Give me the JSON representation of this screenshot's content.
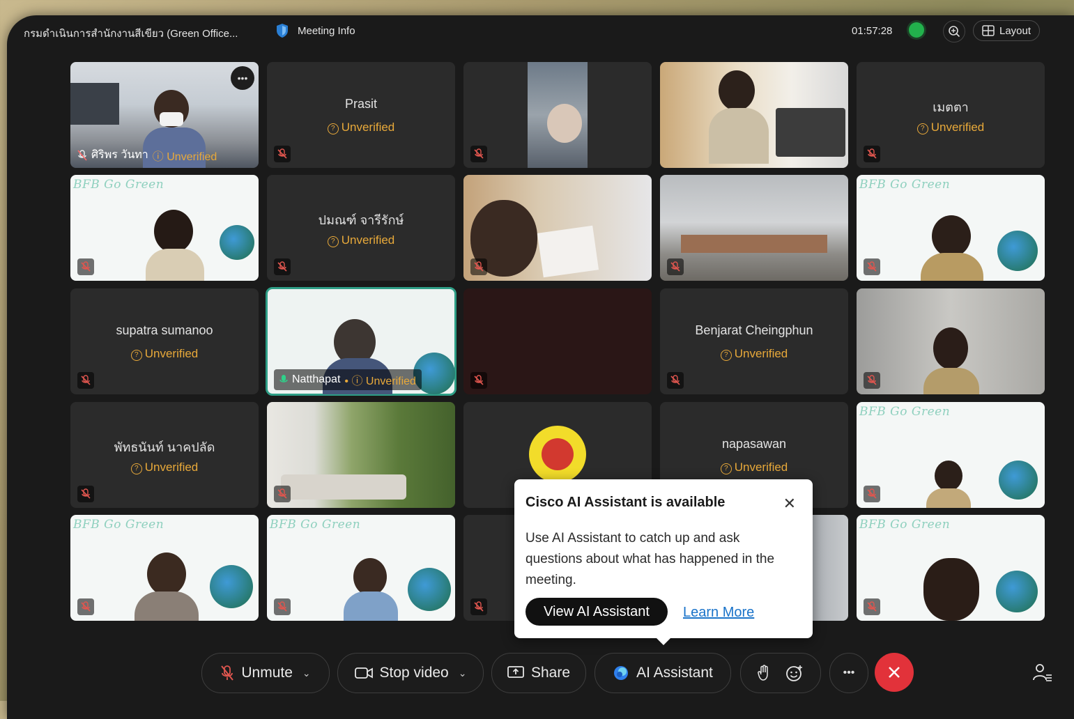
{
  "meeting": {
    "title": "กรมดำเนินการสำนักงานสีเขียว (Green Office...",
    "info_label": "Meeting Info",
    "clock": "01:57:28",
    "layout_label": "Layout"
  },
  "colors": {
    "accent_green": "#22b14c",
    "unverified": "#e8a93a",
    "end_red": "#e2323a",
    "active_border": "#2e9e86"
  },
  "unverified": "Unverified",
  "tiles": {
    "t1": {
      "label": "ศิริพร วันทา"
    },
    "t2": {
      "name": "Prasit"
    },
    "t5": {
      "name": "เมตตา"
    },
    "t6": {
      "banner": "BFB Go Green"
    },
    "t7": {
      "name": "ปมณฑ์ จารีรักษ์"
    },
    "t10": {
      "banner": "BFB Go Green"
    },
    "t11": {
      "name": "supatra sumanoo"
    },
    "t12": {
      "label": "Natthapat"
    },
    "t14": {
      "name": "Benjarat Cheingphun"
    },
    "t16": {
      "name": "พัทธนันท์ นาคปลัด"
    },
    "t19": {
      "name": "napasawan"
    },
    "t20": {
      "banner": "BFB Go Green"
    },
    "t21": {
      "banner": "BFB Go Green"
    },
    "t22": {
      "banner": "BFB Go Green"
    },
    "t25": {
      "banner": "BFB Go Green"
    }
  },
  "popup": {
    "title": "Cisco AI Assistant is available",
    "body": "Use AI Assistant to catch up and ask questions about what has happened in the meeting.",
    "primary": "View AI Assistant",
    "link": "Learn More"
  },
  "controls": {
    "unmute": "Unmute",
    "stop_video": "Stop video",
    "share": "Share",
    "ai_assistant": "AI Assistant"
  }
}
